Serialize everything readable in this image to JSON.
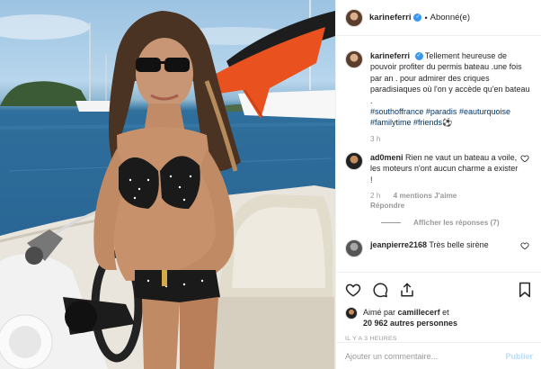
{
  "header": {
    "username": "karineferri",
    "separator": "•",
    "follow_status": "Abonné(e)"
  },
  "caption": {
    "username": "karineferri",
    "text": "Tellement heureuse de pouvoir profiter du permis bateau .une fois par an . pour admirer des criques paradisiaques où l'on y accède qu'en bateau .",
    "hashtags": [
      "#southoffrance",
      "#paradis",
      "#eauturquoise",
      "#familytime",
      "#friends"
    ],
    "emoji": "⚽",
    "time": "3 h"
  },
  "comments": [
    {
      "username": "ad0meni",
      "text": "Rien ne vaut un bateau a voile, les moteurs n'ont aucun charme a exister !",
      "time": "2 h",
      "likes": "4 mentions J'aime",
      "reply": "Répondre",
      "view_replies": "Afficher les réponses (7)"
    },
    {
      "username": "jeanpierre2168",
      "text": "Très belle sirène"
    }
  ],
  "likes": {
    "prefix": "Aimé par",
    "user": "camillecerf",
    "and": "et",
    "others": "20 962 autres personnes"
  },
  "post_time": "IL Y A 3 HEURES",
  "comment_box": {
    "placeholder": "Ajouter un commentaire...",
    "publish": "Publier"
  },
  "icons": [
    "heart-icon",
    "comment-icon",
    "share-icon",
    "bookmark-icon",
    "verified-icon"
  ],
  "colors": {
    "link": "#003569",
    "verified": "#3897f0",
    "muted": "#999999",
    "publish": "#b2dffc"
  }
}
